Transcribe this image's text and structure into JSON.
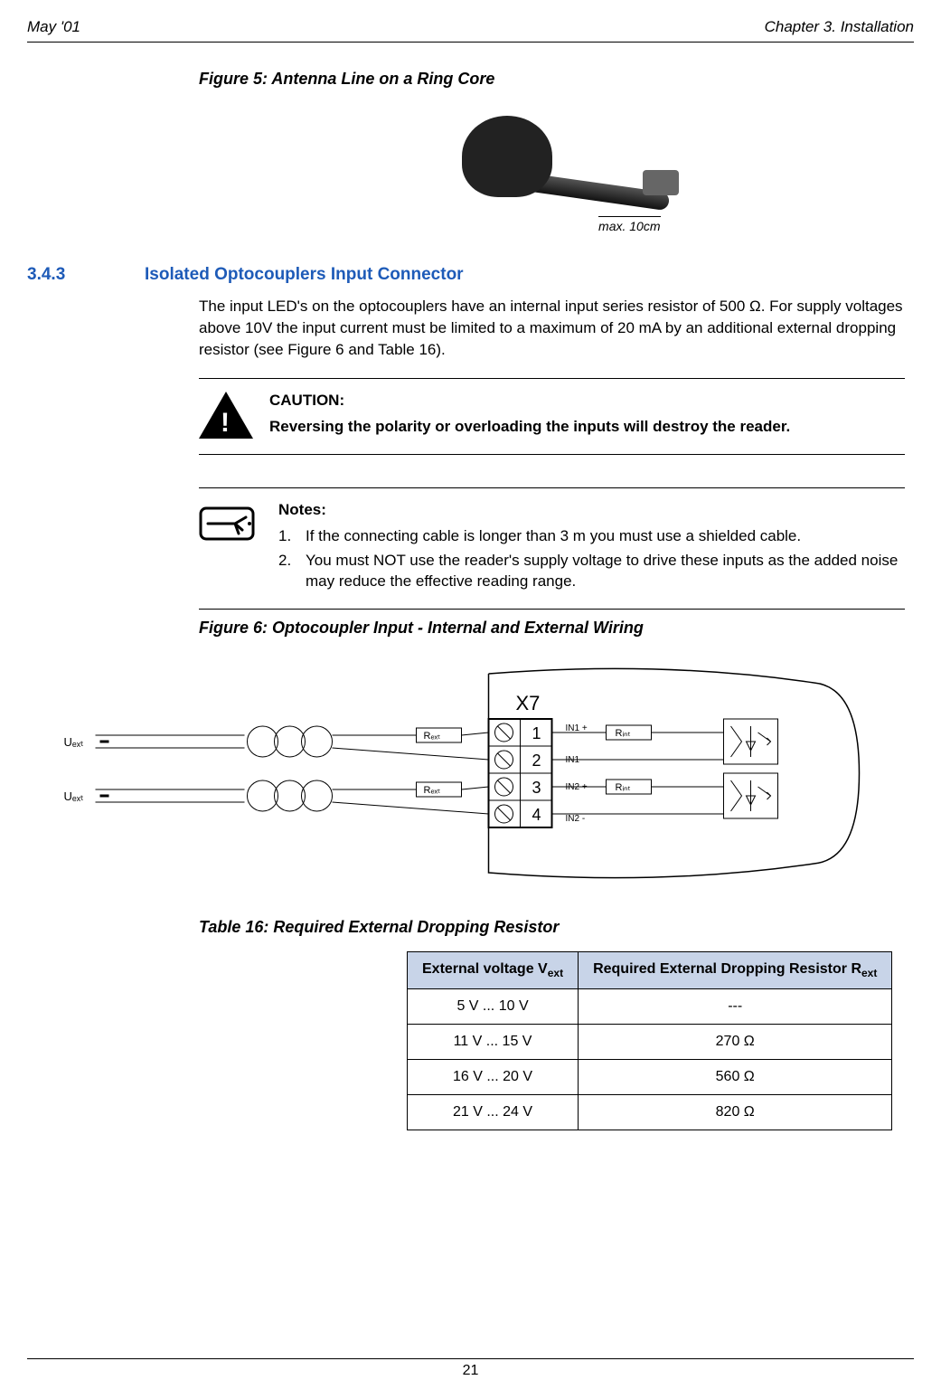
{
  "header": {
    "left": "May '01",
    "right": "Chapter 3. Installation"
  },
  "figure5": {
    "caption": "Figure 5: Antenna Line on a Ring Core",
    "max_label": "max. 10cm"
  },
  "section": {
    "number": "3.4.3",
    "title": "Isolated Optocouplers Input Connector",
    "body": "The input LED's on the optocouplers have an internal input series resistor of 500 Ω. For supply voltages above 10V the input current must be limited to a maximum of 20 mA by an additional external dropping resistor (see Figure 6 and Table 16)."
  },
  "caution": {
    "heading": "CAUTION:",
    "body": "Reversing the polarity or overloading the inputs will destroy the reader."
  },
  "notes": {
    "heading": "Notes:",
    "items": [
      {
        "num": "1.",
        "text": "If the connecting cable is longer than 3 m you must use a shielded cable."
      },
      {
        "num": "2.",
        "text": "You must NOT use the reader's supply voltage to drive these inputs as the added noise may reduce the effective reading range."
      }
    ]
  },
  "figure6": {
    "caption": "Figure 6: Optocoupler Input - Internal and External Wiring",
    "x7_label": "X7",
    "uext1": "Uₑₓₜ",
    "uext2": "Uₑₓₜ",
    "rext": "Rₑₓₜ",
    "rint": "Rᵢₙₜ",
    "pins": [
      "1",
      "2",
      "3",
      "4"
    ],
    "in_labels": [
      "IN1 +",
      "IN1 -",
      "IN2 +",
      "IN2 -"
    ]
  },
  "table16": {
    "caption": "Table 16: Required External Dropping Resistor",
    "headers": [
      "External voltage V",
      "Required External Dropping Resistor R"
    ],
    "header_subs": [
      "ext",
      "ext"
    ],
    "rows": [
      [
        "5 V ... 10 V",
        "---"
      ],
      [
        "11 V ... 15 V",
        "270 Ω"
      ],
      [
        "16 V ... 20 V",
        "560 Ω"
      ],
      [
        "21 V ... 24 V",
        "820 Ω"
      ]
    ]
  },
  "page_number": "21"
}
